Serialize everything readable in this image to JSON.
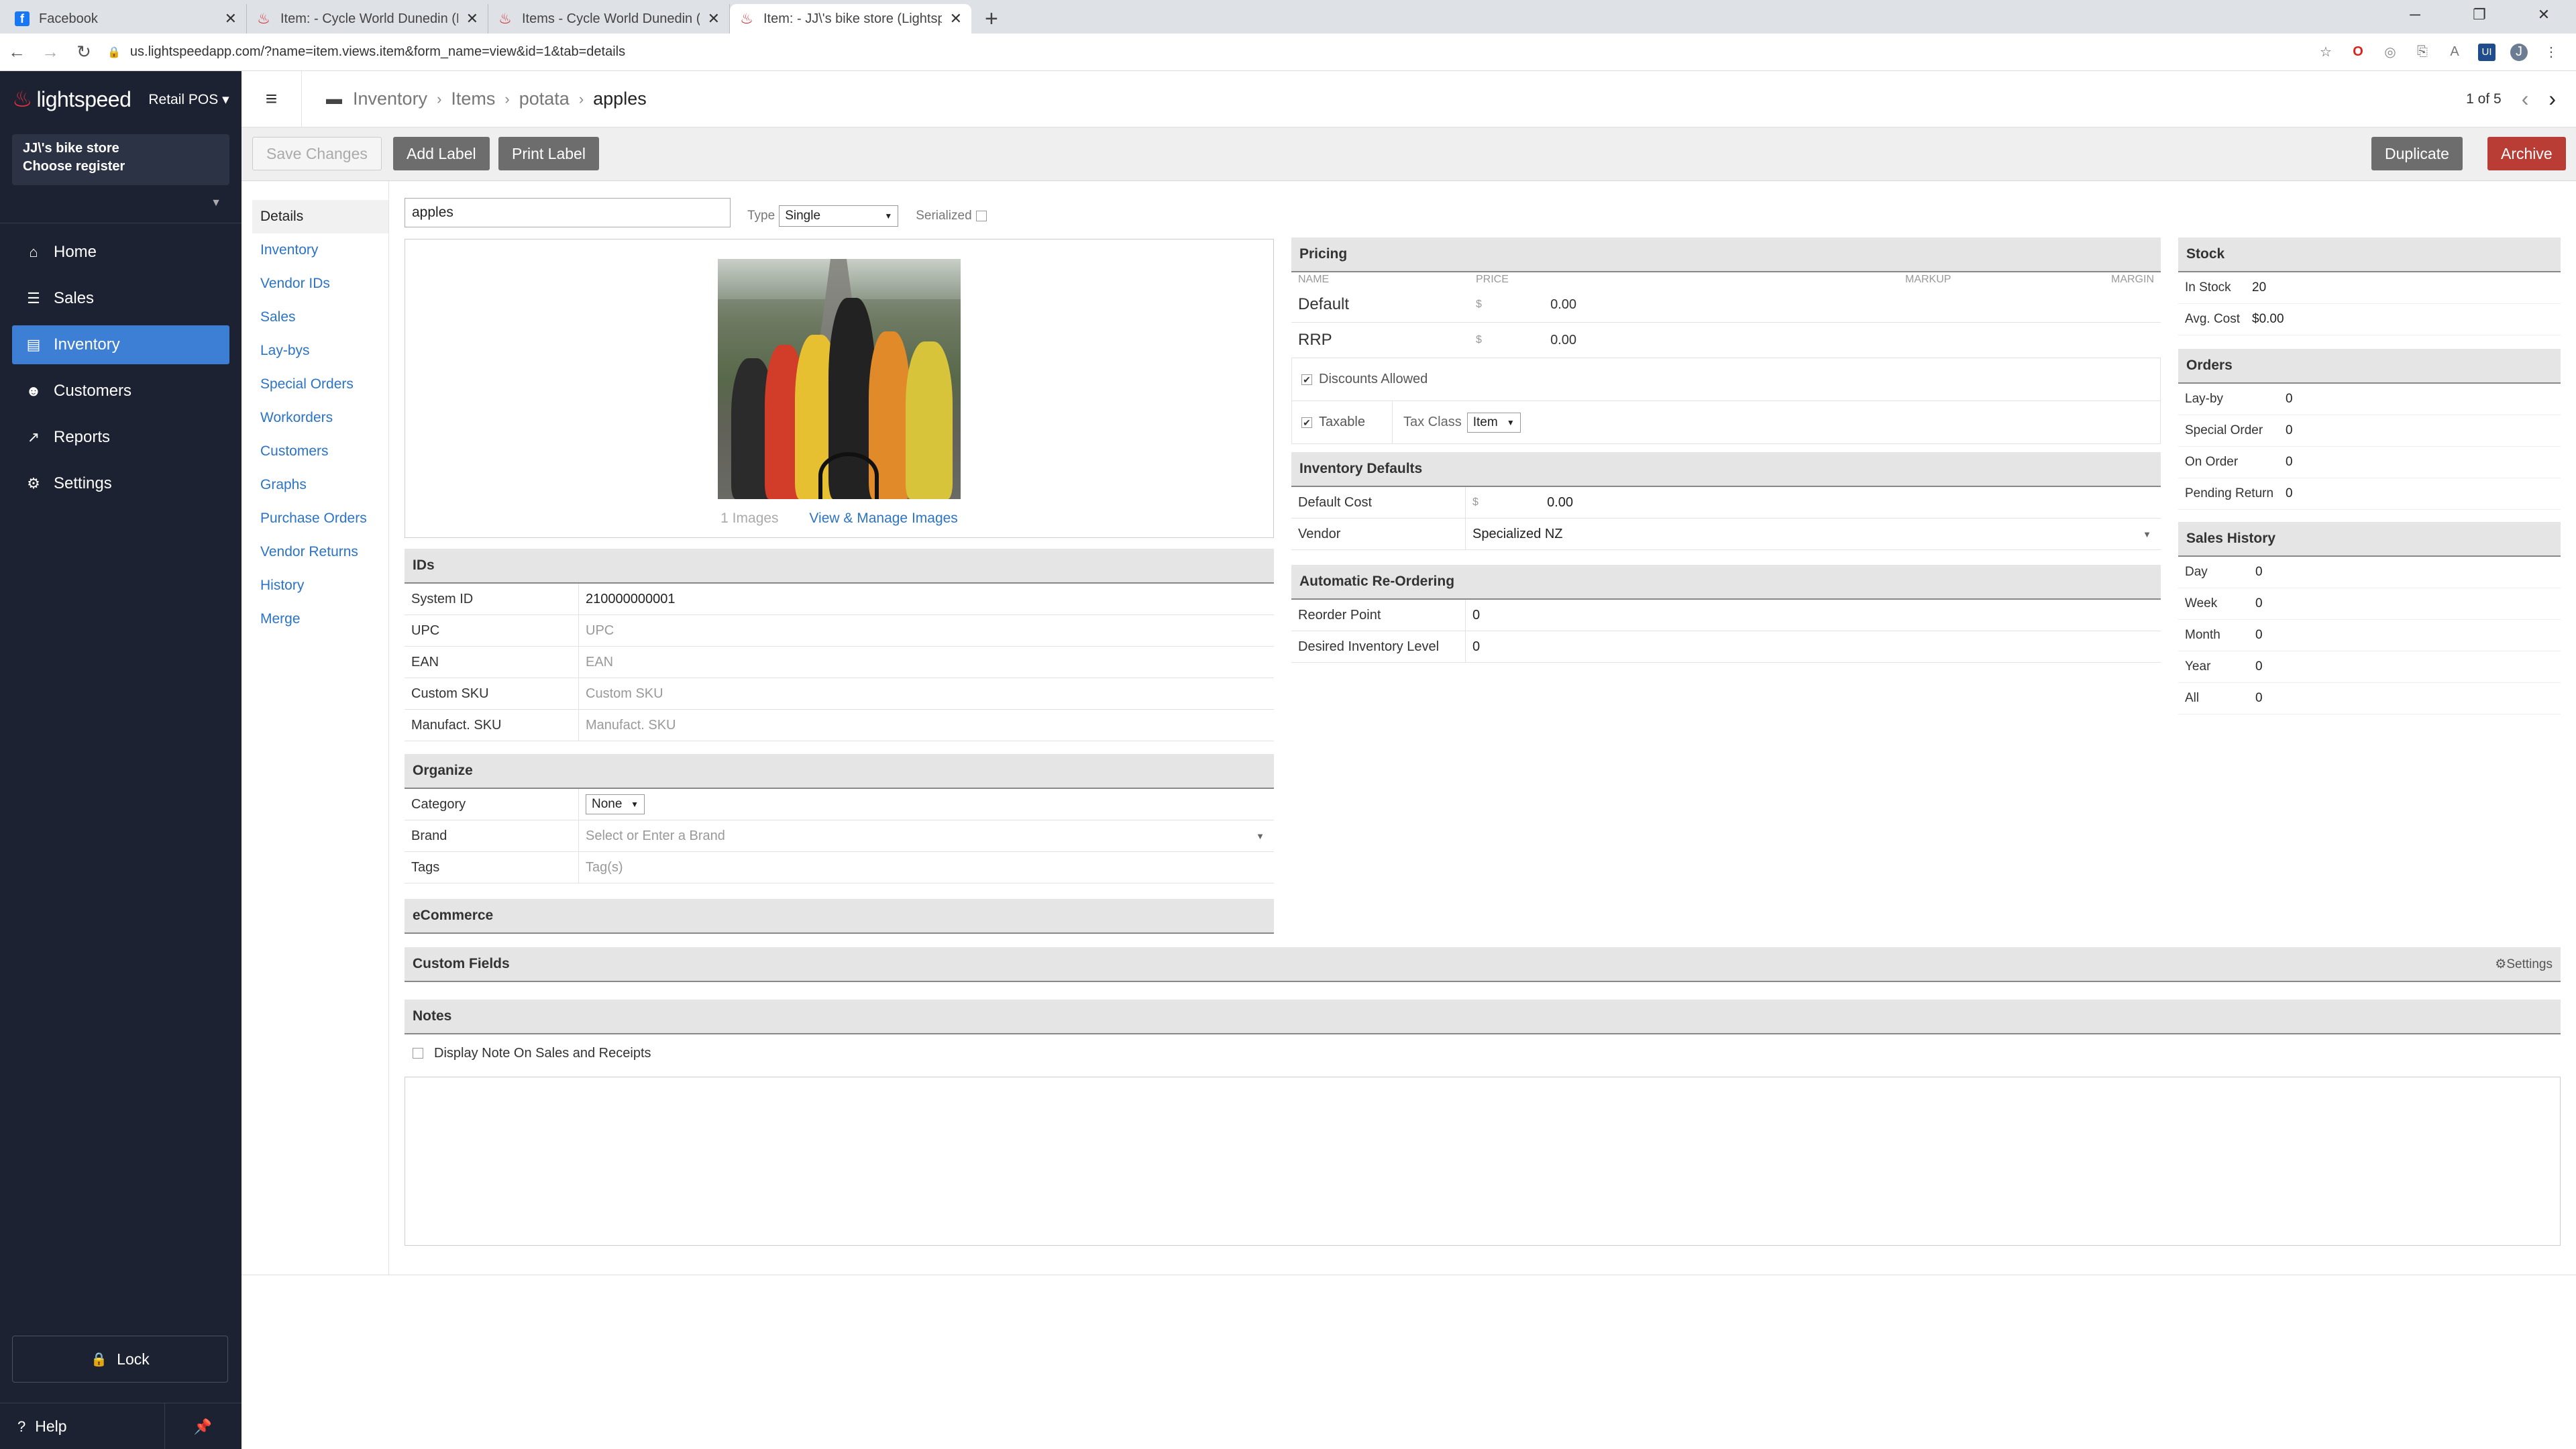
{
  "browser": {
    "tabs": [
      {
        "title": "Facebook",
        "icon": "facebook-icon"
      },
      {
        "title": "Item: - Cycle World Dunedin (Lig",
        "icon": "lightspeed-icon"
      },
      {
        "title": "Items - Cycle World Dunedin (Li",
        "icon": "lightspeed-icon"
      },
      {
        "title": "Item: - JJ\\'s bike store (Lightspee",
        "icon": "lightspeed-icon"
      }
    ],
    "url": "us.lightspeedapp.com/?name=item.views.item&form_name=view&id=1&tab=details"
  },
  "sidebar": {
    "logo": "lightspeed",
    "product": "Retail POS",
    "store_name": "JJ\\'s bike store",
    "register": "Choose register",
    "items": [
      {
        "label": "Home",
        "icon": "home-icon"
      },
      {
        "label": "Sales",
        "icon": "sales-icon"
      },
      {
        "label": "Inventory",
        "icon": "inventory-icon"
      },
      {
        "label": "Customers",
        "icon": "customers-icon"
      },
      {
        "label": "Reports",
        "icon": "reports-icon"
      },
      {
        "label": "Settings",
        "icon": "gear-icon"
      }
    ],
    "lock": "Lock",
    "help": "Help"
  },
  "header": {
    "breadcrumb": [
      "Inventory",
      "Items",
      "potata",
      "apples"
    ],
    "pager": "1 of 5"
  },
  "toolbar": {
    "save": "Save Changes",
    "add_label": "Add Label",
    "print_label": "Print Label",
    "duplicate": "Duplicate",
    "archive": "Archive"
  },
  "submenu": [
    "Details",
    "Inventory",
    "Vendor IDs",
    "Sales",
    "Lay-bys",
    "Special Orders",
    "Workorders",
    "Customers",
    "Graphs",
    "Purchase Orders",
    "Vendor Returns",
    "History",
    "Merge"
  ],
  "item": {
    "name": "apples",
    "type_label": "Type",
    "type_value": "Single",
    "serialized_label": "Serialized",
    "images_count": "1 Images",
    "manage_images": "View & Manage Images"
  },
  "ids": {
    "title": "IDs",
    "rows": [
      {
        "k": "System ID",
        "v": "210000000001",
        "dark": true
      },
      {
        "k": "UPC",
        "v": "UPC"
      },
      {
        "k": "EAN",
        "v": "EAN"
      },
      {
        "k": "Custom SKU",
        "v": "Custom SKU"
      },
      {
        "k": "Manufact. SKU",
        "v": "Manufact. SKU"
      }
    ]
  },
  "organize": {
    "title": "Organize",
    "category_label": "Category",
    "category_value": "None",
    "brand_label": "Brand",
    "brand_placeholder": "Select or Enter a Brand",
    "tags_label": "Tags",
    "tags_placeholder": "Tag(s)"
  },
  "ecommerce": {
    "title": "eCommerce"
  },
  "custom_fields": {
    "title": "Custom Fields",
    "settings": "Settings"
  },
  "notes": {
    "title": "Notes",
    "display_label": "Display Note On Sales and Receipts"
  },
  "pricing": {
    "title": "Pricing",
    "cols": {
      "name": "NAME",
      "price": "PRICE",
      "markup": "MARKUP",
      "margin": "MARGIN"
    },
    "currency": "$",
    "rows": [
      {
        "name": "Default",
        "price": "0.00"
      },
      {
        "name": "RRP",
        "price": "0.00"
      }
    ],
    "discounts": "Discounts Allowed",
    "taxable": "Taxable",
    "tax_class_label": "Tax Class",
    "tax_class_value": "Item"
  },
  "inventory_defaults": {
    "title": "Inventory Defaults",
    "default_cost_label": "Default Cost",
    "default_cost_value": "0.00",
    "vendor_label": "Vendor",
    "vendor_value": "Specialized NZ"
  },
  "reorder": {
    "title": "Automatic Re-Ordering",
    "point_label": "Reorder Point",
    "point_value": "0",
    "desired_label": "Desired Inventory Level",
    "desired_value": "0"
  },
  "stock": {
    "title": "Stock",
    "rows": [
      {
        "k": "In Stock",
        "v": "20"
      },
      {
        "k": "Avg. Cost",
        "v": "$0.00"
      }
    ]
  },
  "orders": {
    "title": "Orders",
    "rows": [
      {
        "k": "Lay-by",
        "v": "0"
      },
      {
        "k": "Special Order",
        "v": "0"
      },
      {
        "k": "On Order",
        "v": "0"
      },
      {
        "k": "Pending Return",
        "v": "0"
      }
    ]
  },
  "sales_history": {
    "title": "Sales History",
    "rows": [
      {
        "k": "Day",
        "v": "0"
      },
      {
        "k": "Week",
        "v": "0"
      },
      {
        "k": "Month",
        "v": "0"
      },
      {
        "k": "Year",
        "v": "0"
      },
      {
        "k": "All",
        "v": "0"
      }
    ]
  },
  "colors": {
    "sidebar": "#1c2232",
    "active": "#3e7fd6",
    "archive": "#b93d34",
    "link": "#2a73c7"
  }
}
